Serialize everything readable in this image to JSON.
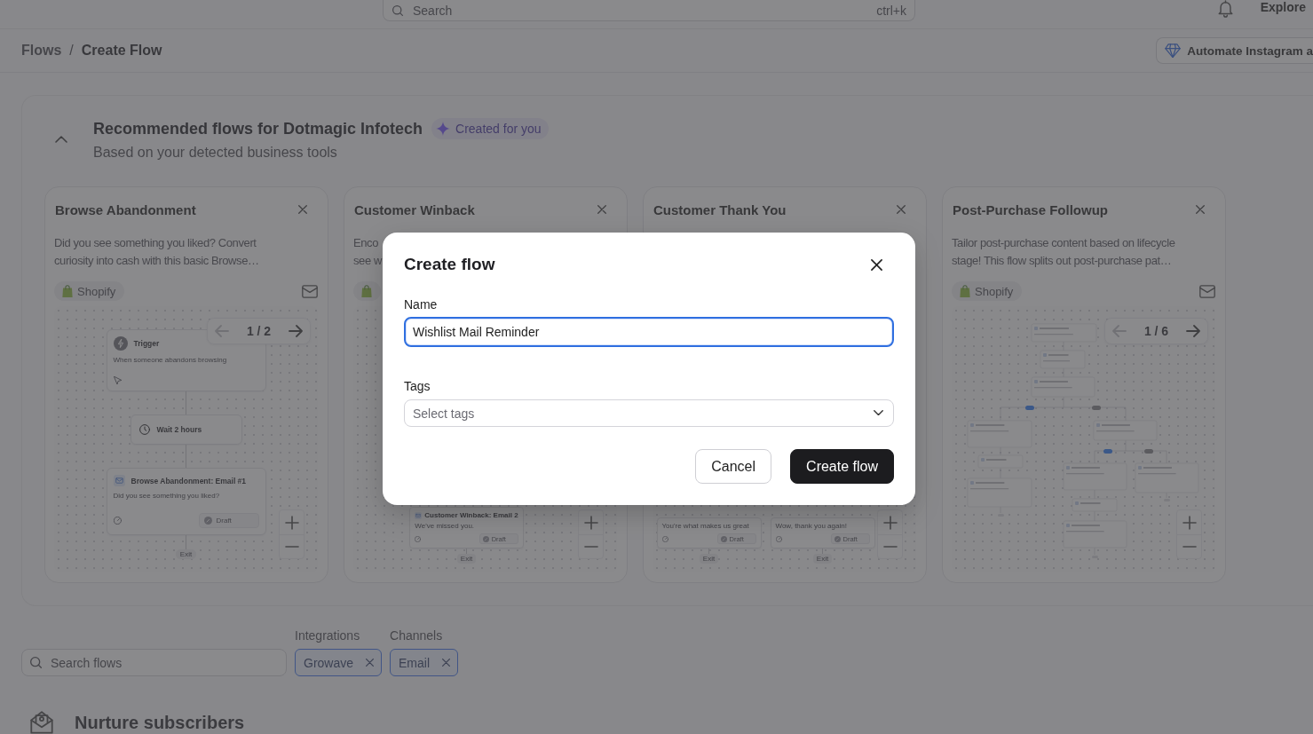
{
  "top_bar": {
    "search": {
      "placeholder": "Search",
      "shortcut": "ctrl+k"
    },
    "explore": "Explore"
  },
  "breadcrumb": {
    "items": [
      "Flows",
      "Create Flow"
    ],
    "separator": "/"
  },
  "promo_button": {
    "label": "Automate Instagram a"
  },
  "recommended": {
    "expanded": true,
    "title": "Recommended flows for Dotmagic Infotech",
    "badge": "Created for you",
    "subtitle": "Based on your detected business tools",
    "cards": [
      {
        "title": "Browse Abandonment",
        "description": [
          "Did you see something you liked? Convert",
          "curiosity into cash with this basic Browse…"
        ],
        "integration": {
          "kind": "shopify",
          "label": "Shopify"
        },
        "channels": [
          {
            "kind": "email"
          }
        ],
        "preview": {
          "kind": "chain",
          "pager": {
            "page": "1 / 2",
            "previous_disabled": true
          },
          "nodes": [
            {
              "kind": "trigger",
              "title": "Trigger",
              "text": "When someone abandons browsing"
            },
            {
              "kind": "wait",
              "title": "Wait 2 hours"
            },
            {
              "kind": "email",
              "title": "Browse Abandonment: Email #1",
              "text": "Did you see something you liked?",
              "status": "Draft"
            },
            {
              "kind": "exit",
              "title": "Exit"
            }
          ]
        }
      },
      {
        "title": "Customer Winback",
        "description": [
          "Enco",
          "see w"
        ],
        "integration": {
          "kind": "shopify"
        },
        "preview": {
          "kind": "branches",
          "branches": [
            {
              "nodes": [
                {
                  "kind": "email",
                  "title": "Customer Winback: Email 2",
                  "text": "We've missed you.",
                  "status": "Draft"
                },
                {
                  "kind": "exit",
                  "title": "Exit"
                }
              ]
            }
          ]
        }
      },
      {
        "title": "Customer Thank You",
        "preview": {
          "kind": "branches",
          "branches": [
            {
              "nodes": [
                {
                  "kind": "email",
                  "text": "You're what makes us great",
                  "status": "Draft"
                },
                {
                  "kind": "exit",
                  "title": "Exit"
                }
              ]
            },
            {
              "nodes": [
                {
                  "kind": "email",
                  "text": "Wow, thank you again!",
                  "status": "Draft"
                },
                {
                  "kind": "exit",
                  "title": "Exit"
                }
              ]
            }
          ]
        }
      },
      {
        "title": "Post-Purchase Followup",
        "description": [
          "Tailor post-purchase content based on lifecycle",
          "stage! This flow splits out post-purchase pat…"
        ],
        "integration": {
          "kind": "shopify",
          "label": "Shopify"
        },
        "channels": [
          {
            "kind": "email"
          }
        ],
        "preview": {
          "kind": "drawing",
          "pager": {
            "page": "1 / 6",
            "previous_disabled": true
          }
        }
      }
    ]
  },
  "filters": {
    "search": {
      "placeholder": "Search flows"
    },
    "groups": [
      {
        "label": "Integrations",
        "chips": [
          "Growave"
        ]
      },
      {
        "label": "Channels",
        "chips": [
          "Email"
        ]
      }
    ]
  },
  "section": {
    "title": "Nurture subscribers"
  },
  "modal": {
    "title": "Create flow",
    "name": {
      "label": "Name",
      "value": "Wishlist Mail Reminder"
    },
    "tags": {
      "label": "Tags",
      "placeholder": "Select tags"
    },
    "buttons": [
      {
        "label": "Cancel",
        "kind": "secondary"
      },
      {
        "label": "Create flow",
        "kind": "primary"
      }
    ]
  }
}
